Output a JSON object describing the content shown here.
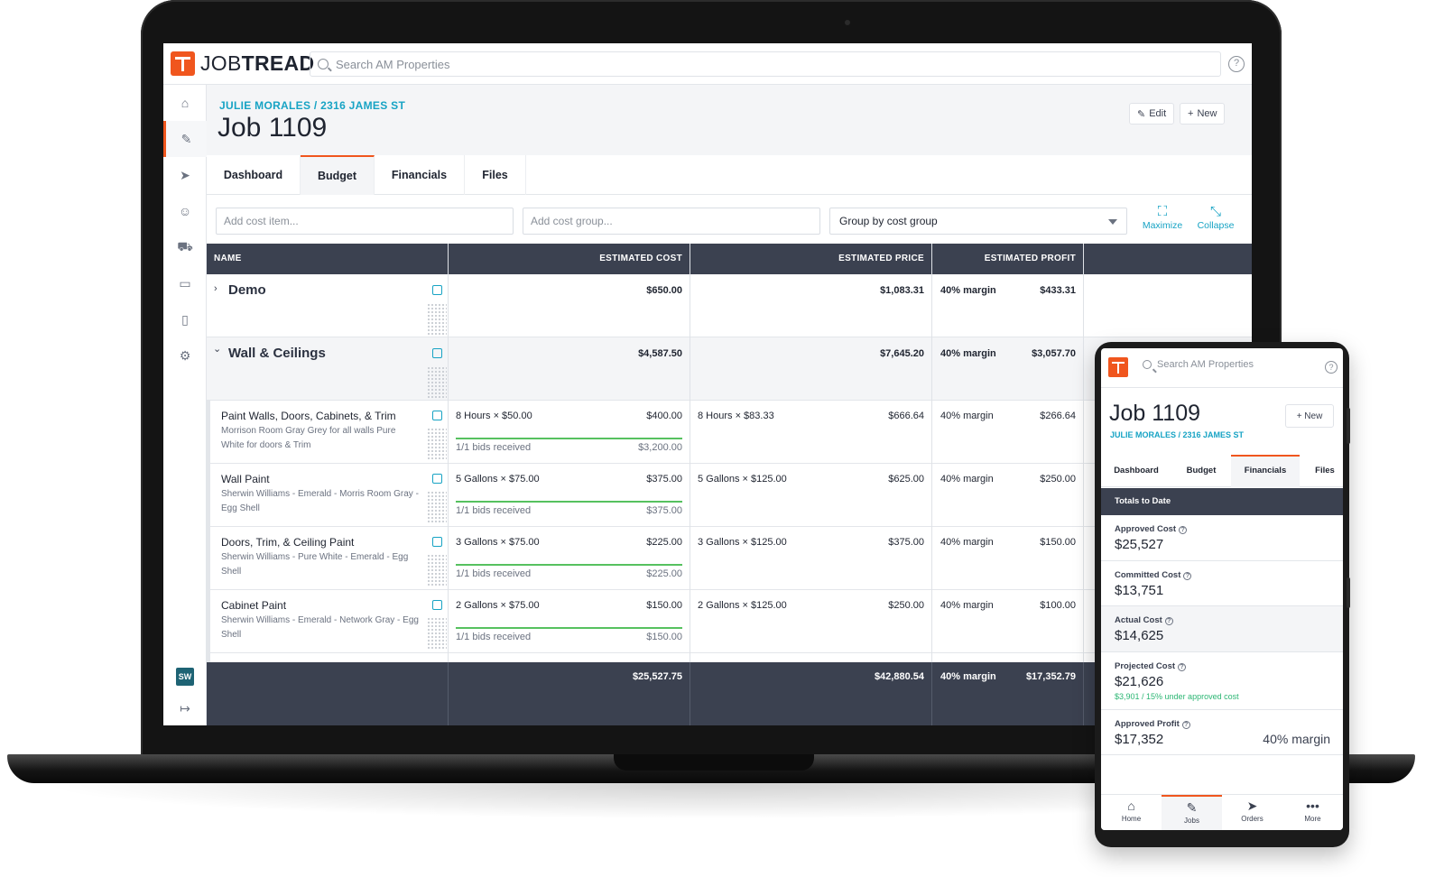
{
  "app": {
    "logo_text_regular": "JOB",
    "logo_text_bold": "TREAD",
    "search_placeholder": "Search AM Properties",
    "help_glyph": "?",
    "brand_color": "#f0561e",
    "accent_color": "#17a3c4"
  },
  "sidebar": {
    "items": [
      {
        "name": "home",
        "icon": "⌂"
      },
      {
        "name": "jobs",
        "icon": "✎"
      },
      {
        "name": "orders",
        "icon": "➤"
      },
      {
        "name": "contacts",
        "icon": "☺"
      },
      {
        "name": "delivery",
        "icon": "⛟"
      },
      {
        "name": "catalog",
        "icon": "▭"
      },
      {
        "name": "documents",
        "icon": "▯"
      },
      {
        "name": "settings",
        "icon": "⚙"
      }
    ],
    "avatar_initials": "SW",
    "logout_icon": "↦",
    "expand_icon": "⤢"
  },
  "job": {
    "breadcrumb": "JULIE MORALES / 2316 JAMES ST",
    "title": "Job 1109",
    "edit_label": "Edit",
    "new_label": "New"
  },
  "tabs": [
    "Dashboard",
    "Budget",
    "Financials",
    "Files"
  ],
  "toolbar": {
    "add_cost_item_placeholder": "Add cost item...",
    "add_cost_group_placeholder": "Add cost group...",
    "group_by_value": "Group by cost group",
    "maximize_label": "Maximize",
    "collapse_label": "Collapse"
  },
  "grid": {
    "columns": [
      "NAME",
      "ESTIMATED COST",
      "ESTIMATED PRICE",
      "ESTIMATED PROFIT"
    ],
    "groups": [
      {
        "name": "Demo",
        "chevron": "›",
        "cost": "$650.00",
        "price": "$1,083.31",
        "margin": "40% margin",
        "profit": "$433.31"
      },
      {
        "name": "Wall & Ceilings",
        "chevron": "⌄",
        "cost": "$4,587.50",
        "price": "$7,645.20",
        "margin": "40% margin",
        "profit": "$3,057.70"
      }
    ],
    "items": [
      {
        "name": "Paint Walls, Doors, Cabinets, & Trim",
        "desc": "Morrison Room Gray Grey for all walls Pure White for doors & Trim",
        "qty_cost": "8 Hours × $50.00",
        "cost": "$400.00",
        "bids": "1/1 bids received",
        "bid_amount": "$3,200.00",
        "qty_price": "8 Hours × $83.33",
        "price": "$666.64",
        "margin": "40% margin",
        "profit": "$266.64"
      },
      {
        "name": "Wall Paint",
        "desc": "Sherwin Williams - Emerald - Morris Room Gray - Egg Shell",
        "qty_cost": "5 Gallons × $75.00",
        "cost": "$375.00",
        "bids": "1/1 bids received",
        "bid_amount": "$375.00",
        "qty_price": "5 Gallons × $125.00",
        "price": "$625.00",
        "margin": "40% margin",
        "profit": "$250.00"
      },
      {
        "name": "Doors, Trim, & Ceiling Paint",
        "desc": "Sherwin Williams - Pure White - Emerald - Egg Shell",
        "qty_cost": "3 Gallons × $75.00",
        "cost": "$225.00",
        "bids": "1/1 bids received",
        "bid_amount": "$225.00",
        "qty_price": "3 Gallons × $125.00",
        "price": "$375.00",
        "margin": "40% margin",
        "profit": "$150.00"
      },
      {
        "name": "Cabinet Paint",
        "desc": "Sherwin Williams - Emerald - Network Gray - Egg Shell",
        "qty_cost": "2 Gallons × $75.00",
        "cost": "$150.00",
        "bids": "1/1 bids received",
        "bid_amount": "$150.00",
        "qty_price": "2 Gallons × $125.00",
        "price": "$250.00",
        "margin": "40% margin",
        "profit": "$100.00"
      }
    ],
    "totals": {
      "cost": "$25,527.75",
      "price": "$42,880.54",
      "margin": "40% margin",
      "profit": "$17,352.79"
    }
  },
  "phone": {
    "search_placeholder": "Search AM Properties",
    "title": "Job 1109",
    "breadcrumb": "JULIE MORALES / 2316 JAMES ST",
    "new_label": "+ New",
    "tabs": [
      "Dashboard",
      "Budget",
      "Financials",
      "Files"
    ],
    "section_title": "Totals to Date",
    "rows": [
      {
        "label": "Approved Cost",
        "value": "$25,527"
      },
      {
        "label": "Committed Cost",
        "value": "$13,751"
      },
      {
        "label": "Actual Cost",
        "value": "$14,625"
      },
      {
        "label": "Projected Cost",
        "value": "$21,626",
        "note": "$3,901 / 15% under approved cost"
      },
      {
        "label": "Approved Profit",
        "value": "$17,352",
        "margin": "40% margin"
      }
    ],
    "nav": [
      {
        "label": "Home",
        "icon": "⌂"
      },
      {
        "label": "Jobs",
        "icon": "✎"
      },
      {
        "label": "Orders",
        "icon": "➤"
      },
      {
        "label": "More",
        "icon": "•••"
      }
    ]
  }
}
